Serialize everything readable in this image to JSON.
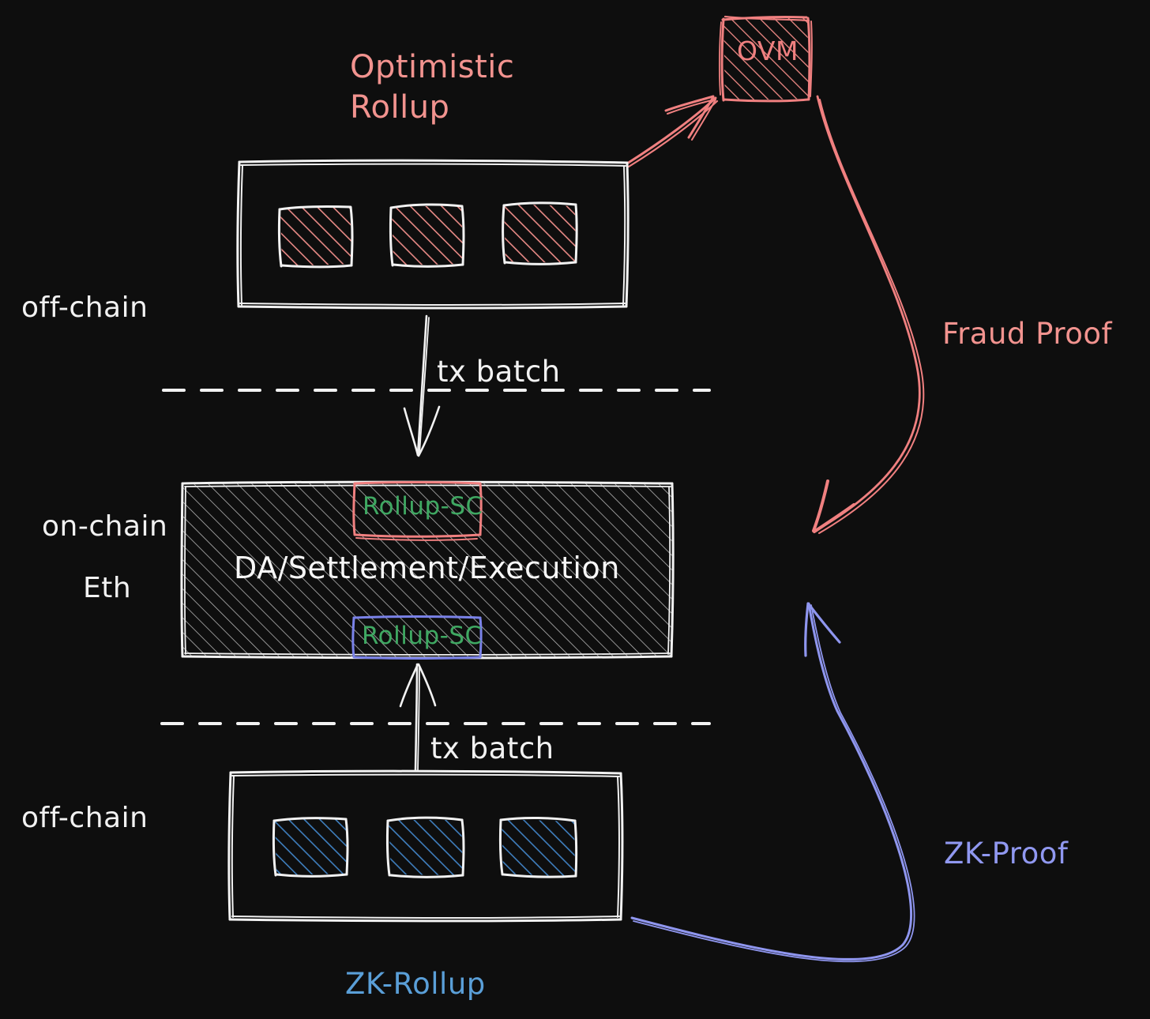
{
  "diagram": {
    "title_context": "Optimistic Rollup vs ZK-Rollup architecture",
    "background_color": "#0e0e0e"
  },
  "colors": {
    "pink": "#f08080",
    "pink_text": "#f2938f",
    "white": "#f2f2f2",
    "green": "#3fa862",
    "blue_bright": "#5a9fd8",
    "blue_soft": "#9098f0",
    "hatch_white": "#cfcfcf"
  },
  "labels": {
    "optimistic_rollup": "Optimistic\nRollup",
    "ovm": "OVM",
    "off_chain_top": "off-chain",
    "off_chain_bottom": "off-chain",
    "on_chain": "on-chain",
    "eth": "Eth",
    "tx_batch_top": "tx batch",
    "tx_batch_bottom": "tx batch",
    "fraud_proof": "Fraud Proof",
    "zk_proof": "ZK-Proof",
    "zk_rollup": "ZK-Rollup",
    "settlement_layer": "DA/Settlement/Execution",
    "rollup_sc_top": "Rollup-SC",
    "rollup_sc_bottom": "Rollup-SC"
  },
  "nodes": {
    "optimistic_batch_container": {
      "name": "optimistic rollup off-chain batch container",
      "tx_blocks": 3,
      "block_fill": "pink-hatch"
    },
    "zk_batch_container": {
      "name": "zk rollup off-chain batch container",
      "tx_blocks": 3,
      "block_fill": "blue-hatch"
    },
    "ovm_box": {
      "name": "OVM execution environment",
      "fill": "pink-hatch"
    },
    "ethereum_layer": {
      "name": "Ethereum L1 layer",
      "fill": "white-hatch",
      "contracts": [
        "Rollup-SC",
        "Rollup-SC"
      ]
    }
  },
  "edges": [
    {
      "from": "optimistic_batch_container",
      "to": "ovm_box",
      "label": "",
      "color": "#f08080"
    },
    {
      "from": "optimistic_batch_container",
      "to": "ethereum_layer",
      "label": "tx batch",
      "color": "#f2f2f2"
    },
    {
      "from": "ovm_box",
      "to": "ethereum_layer",
      "label": "Fraud Proof",
      "color": "#f08080"
    },
    {
      "from": "zk_batch_container",
      "to": "ethereum_layer",
      "label": "tx batch",
      "color": "#f2f2f2"
    },
    {
      "from": "zk_batch_container",
      "to": "ethereum_layer",
      "label": "ZK-Proof",
      "color": "#9098f0"
    }
  ],
  "separators": [
    {
      "name": "off-chain / on-chain divider (top)"
    },
    {
      "name": "on-chain / off-chain divider (bottom)"
    }
  ]
}
